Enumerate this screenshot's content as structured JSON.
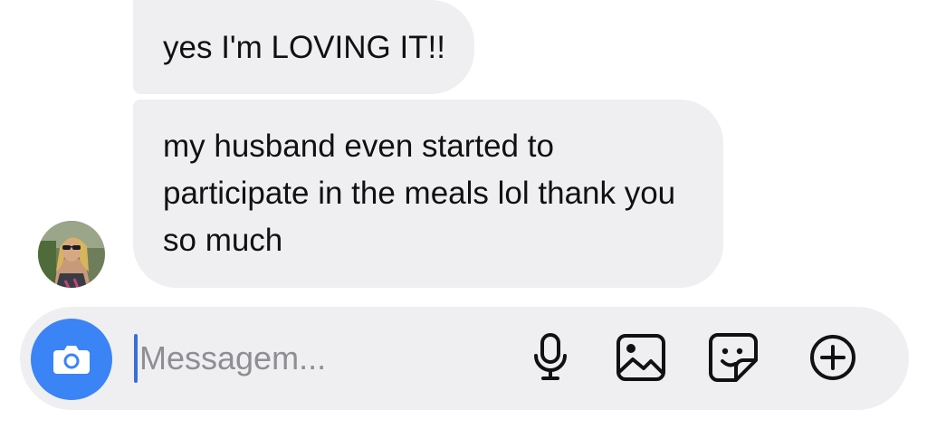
{
  "conversation": {
    "messages": [
      {
        "text": "yes I'm LOVING IT!!"
      },
      {
        "text": "my husband even started to participate in the meals lol thank you so much"
      }
    ],
    "sender_avatar": "woman-sunglasses-avatar"
  },
  "composer": {
    "placeholder": "Messagem...",
    "value": "",
    "icons": [
      "camera-icon",
      "microphone-icon",
      "gallery-icon",
      "sticker-icon",
      "plus-icon"
    ]
  },
  "colors": {
    "bubble": "#efeff1",
    "composer": "#efeff1",
    "camera_button": "#3a84f5",
    "caret": "#3a6fd8",
    "placeholder": "#8e8e93",
    "text": "#111111"
  }
}
